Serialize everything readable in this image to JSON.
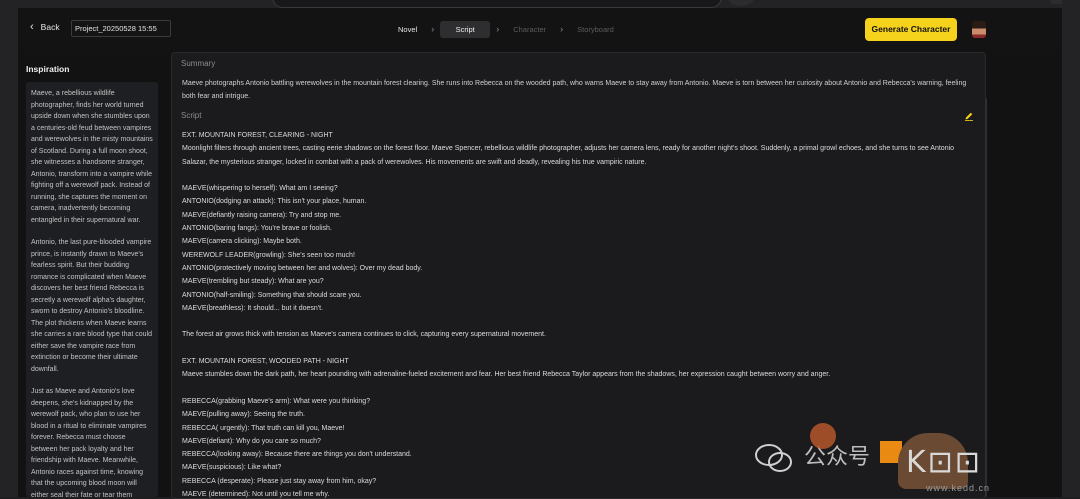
{
  "header": {
    "back_label": "Back",
    "project_name": "Project_20250528 15:55",
    "steps": [
      "Novel",
      "Script",
      "Character",
      "Storyboard"
    ],
    "generate_label": "Generate Character"
  },
  "inspiration": {
    "title": "Inspiration",
    "paragraphs": [
      "Maeve, a rebellious wildlife photographer, finds her world turned upside down when she stumbles upon a centuries-old feud between vampires and werewolves in the misty mountains of Scotland. During a full moon shoot, she witnesses a handsome stranger, Antonio, transform into a vampire while fighting off a werewolf pack. Instead of running, she captures the moment on camera, inadvertently becoming entangled in their supernatural war.",
      "Antonio, the last pure-blooded vampire prince, is instantly drawn to Maeve's fearless spirit. But their budding romance is complicated when Maeve discovers her best friend Rebecca is secretly a werewolf alpha's daughter, sworn to destroy Antonio's bloodline. The plot thickens when Maeve learns she carries a rare blood type that could either save the vampire race from extinction or become their ultimate downfall.",
      "Just as Maeve and Antonio's love deepens, she's kidnapped by the werewolf pack, who plan to use her blood in a ritual to eliminate vampires forever. Rebecca must choose between her pack loyalty and her friendship with Maeve. Meanwhile, Antonio races against time, knowing that the upcoming blood moon will either seal their fate or tear them"
    ]
  },
  "summary": {
    "label": "Summary",
    "text": "Maeve photographs Antonio battling werewolves in the mountain forest clearing. She runs into Rebecca on the wooded path, who warns Maeve to stay away from Antonio. Maeve is torn between her curiosity about Antonio and Rebecca's warning, feeling both fear and intrigue."
  },
  "script": {
    "label": "Script",
    "lines": [
      "EXT. MOUNTAIN FOREST, CLEARING - NIGHT",
      "Moonlight filters through ancient trees, casting eerie shadows on the forest floor. Maeve Spencer, rebellious wildlife photographer, adjusts her camera lens, ready for another night's shoot. Suddenly, a primal growl echoes, and she turns to see Antonio Salazar, the mysterious stranger, locked in combat with a pack of werewolves. His movements are swift and deadly, revealing his true vampiric nature.",
      "",
      "MAEVE(whispering to herself): What am I seeing?",
      "ANTONIO(dodging an attack): This isn't your place, human.",
      "MAEVE(defiantly raising camera): Try and stop me.",
      "ANTONIO(baring fangs): You're brave or foolish.",
      "MAEVE(camera clicking): Maybe both.",
      "WEREWOLF LEADER(growling): She's seen too much!",
      "ANTONIO(protectively moving between her and wolves): Over my dead body.",
      "MAEVE(trembling but steady): What are you?",
      "ANTONIO(half-smiling): Something that should scare you.",
      "MAEVE(breathless): It should... but it doesn't.",
      "",
      "The forest air grows thick with tension as Maeve's camera continues to click, capturing every supernatural movement.",
      "",
      "EXT. MOUNTAIN FOREST, WOODED PATH - NIGHT",
      "Maeve stumbles down the dark path, her heart pounding with adrenaline-fueled excitement and fear. Her best friend Rebecca Taylor appears from the shadows, her expression caught between worry and anger.",
      "",
      "REBECCA(grabbing Maeve's arm): What were you thinking?",
      "MAEVE(pulling away): Seeing the truth.",
      "REBECCA( urgently): That truth can kill you, Maeve!",
      "MAEVE(defiant): Why do you care so much?",
      "REBECCA(looking away): Because there are things you don't understand.",
      "MAEVE(suspicious): Like what?",
      "REBECCA (desperate): Please just stay away from him, okay?",
      "MAEVE (determined): Not until you tell me why."
    ]
  },
  "watermark": {
    "text": "公众号",
    "url": "www.kedd.cn"
  },
  "colors": {
    "accent": "#f5d21c",
    "background": "#121212",
    "panel": "#1b1b1d"
  }
}
